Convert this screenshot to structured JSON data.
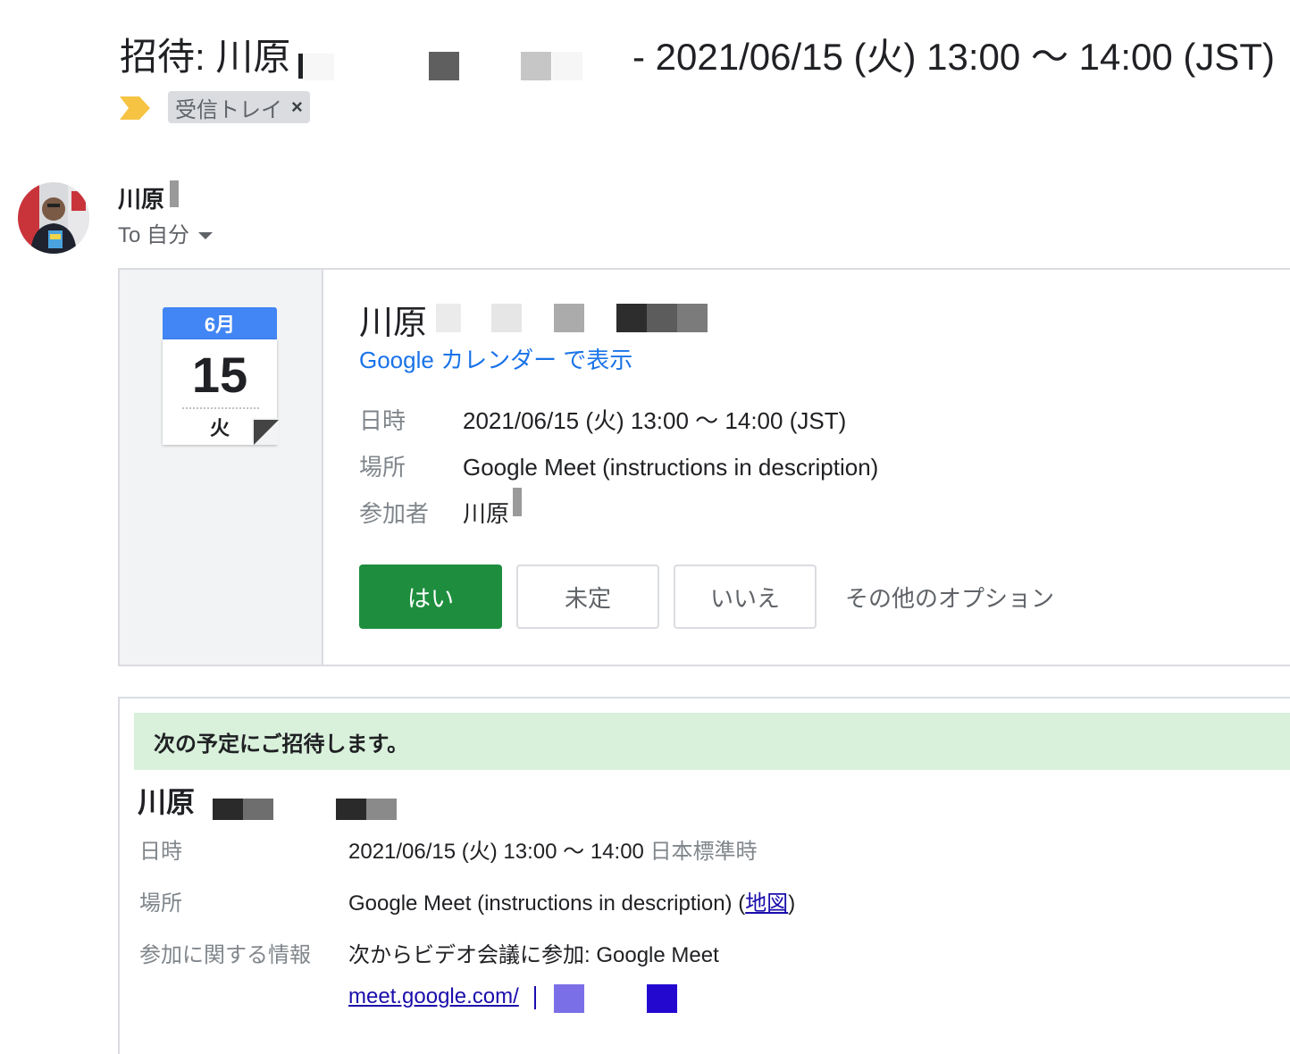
{
  "subject": {
    "title": "招待: 川原",
    "date_range": "- 2021/06/15 (火) 13:00 〜 14:00 (JST)"
  },
  "label": {
    "name": "受信トレイ",
    "remove": "×",
    "arrow_color": "#f6c343"
  },
  "sender": {
    "name": "川原",
    "to_label": "To 自分"
  },
  "invite_card": {
    "calendar": {
      "month": "6月",
      "day": "15",
      "weekday": "火"
    },
    "event_title": "川原",
    "calendar_link": "Google カレンダー で表示",
    "rows": [
      {
        "label": "日時",
        "value": "2021/06/15 (火) 13:00 〜 14:00 (JST)"
      },
      {
        "label": "場所",
        "value": "Google Meet (instructions in description)"
      },
      {
        "label": "参加者",
        "value": "川原"
      }
    ],
    "rsvp": {
      "yes": "はい",
      "maybe": "未定",
      "no": "いいえ",
      "more": "その他のオプション"
    }
  },
  "description": {
    "banner": "次の予定にご招待します。",
    "title": "川原",
    "when_label": "日時",
    "when_value": "2021/06/15 (火) 13:00 〜 14:00",
    "when_tz": "日本標準時",
    "where_label": "場所",
    "where_value": "Google Meet (instructions in description) (",
    "map_link": "地図",
    "where_close": ")",
    "join_label": "参加に関する情報",
    "join_value": "次からビデオ会議に参加: Google Meet",
    "meet_link": "meet.google.com/"
  },
  "colors": {
    "accept_green": "#1e8e3e",
    "calendar_blue": "#4285f4",
    "link_blue": "#1a73e8",
    "banner_green": "#d9f1db"
  }
}
